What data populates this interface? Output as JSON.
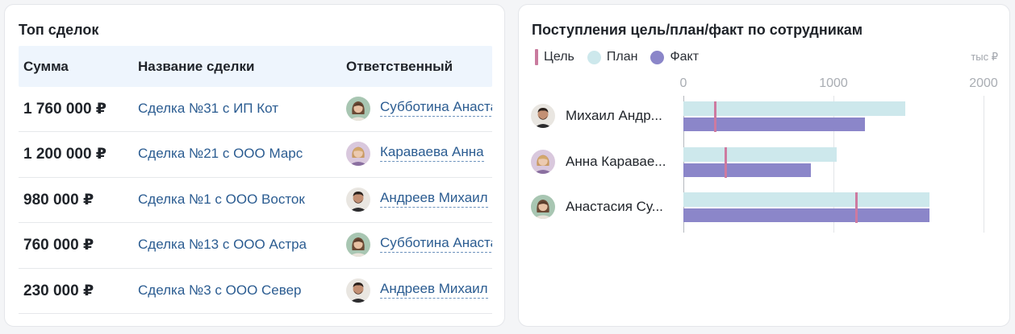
{
  "deals": {
    "title": "Топ сделок",
    "columns": [
      "Сумма",
      "Название сделки",
      "Ответственный"
    ],
    "rows": [
      {
        "sum": "1 760 000 ₽",
        "name": "Сделка №31 с ИП Кот",
        "responsible": "Субботина Анастасия",
        "avatar": "avatar-anastasia"
      },
      {
        "sum": "1 200 000 ₽",
        "name": "Сделка №21 с ООО Марс",
        "responsible": "Караваева Анна",
        "avatar": "avatar-anna"
      },
      {
        "sum": "980 000 ₽",
        "name": "Сделка №1 с ООО Восток",
        "responsible": "Андреев Михаил",
        "avatar": "avatar-mikhail"
      },
      {
        "sum": "760 000 ₽",
        "name": "Сделка №13 с ООО Астра",
        "responsible": "Субботина Анастасия",
        "avatar": "avatar-anastasia"
      },
      {
        "sum": "230 000 ₽",
        "name": "Сделка №3 с ООО Север",
        "responsible": "Андреев Михаил",
        "avatar": "avatar-mikhail"
      }
    ]
  },
  "chart": {
    "title": "Поступления цель/план/факт по сотрудникам",
    "unit": "тыс ₽",
    "legend": [
      {
        "label": "Цель",
        "color": "#cd7aa0"
      },
      {
        "label": "План",
        "color": "#cde8ec"
      },
      {
        "label": "Факт",
        "color": "#8b86c9"
      }
    ]
  },
  "chart_data": {
    "type": "bar",
    "orientation": "horizontal",
    "title": "Поступления цель/план/факт по сотрудникам",
    "unit": "тыс ₽",
    "xlim": [
      0,
      2000
    ],
    "ticks": [
      0,
      1000,
      2000
    ],
    "grid": true,
    "legend_position": "top-left",
    "categories": [
      "Михаил Андреев",
      "Анна Караваева",
      "Анастасия Субботина"
    ],
    "category_labels": [
      "Михаил Андр...",
      "Анна Каравае...",
      "Анастасия Су..."
    ],
    "category_avatars": [
      "avatar-mikhail",
      "avatar-anna",
      "avatar-anastasia"
    ],
    "series": [
      {
        "name": "Цель",
        "values": [
          210,
          280,
          1150
        ],
        "color": "#cd7aa0"
      },
      {
        "name": "План",
        "values": [
          1480,
          1020,
          1640
        ],
        "color": "#cde8ec"
      },
      {
        "name": "Факт",
        "values": [
          1210,
          850,
          1640
        ],
        "color": "#8b86c9"
      }
    ]
  }
}
